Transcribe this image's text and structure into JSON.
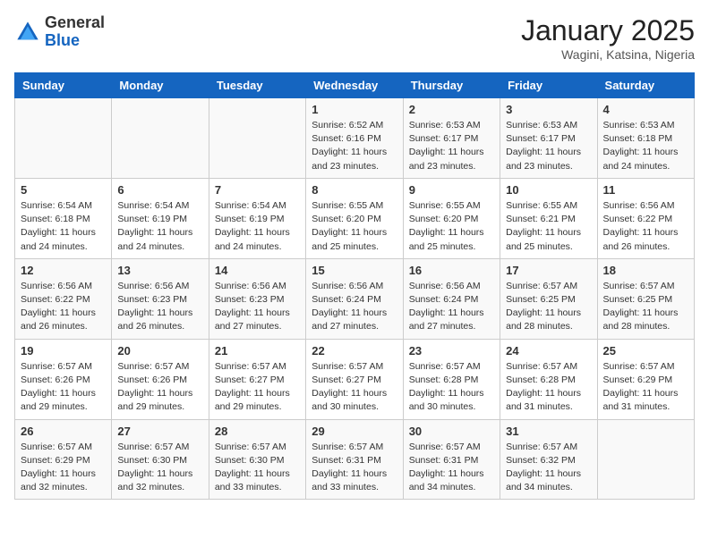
{
  "header": {
    "logo_general": "General",
    "logo_blue": "Blue",
    "month": "January 2025",
    "location": "Wagini, Katsina, Nigeria"
  },
  "weekdays": [
    "Sunday",
    "Monday",
    "Tuesday",
    "Wednesday",
    "Thursday",
    "Friday",
    "Saturday"
  ],
  "weeks": [
    [
      {
        "day": "",
        "info": ""
      },
      {
        "day": "",
        "info": ""
      },
      {
        "day": "",
        "info": ""
      },
      {
        "day": "1",
        "sunrise": "6:52 AM",
        "sunset": "6:16 PM",
        "daylight": "11 hours and 23 minutes."
      },
      {
        "day": "2",
        "sunrise": "6:53 AM",
        "sunset": "6:17 PM",
        "daylight": "11 hours and 23 minutes."
      },
      {
        "day": "3",
        "sunrise": "6:53 AM",
        "sunset": "6:17 PM",
        "daylight": "11 hours and 23 minutes."
      },
      {
        "day": "4",
        "sunrise": "6:53 AM",
        "sunset": "6:18 PM",
        "daylight": "11 hours and 24 minutes."
      }
    ],
    [
      {
        "day": "5",
        "sunrise": "6:54 AM",
        "sunset": "6:18 PM",
        "daylight": "11 hours and 24 minutes."
      },
      {
        "day": "6",
        "sunrise": "6:54 AM",
        "sunset": "6:19 PM",
        "daylight": "11 hours and 24 minutes."
      },
      {
        "day": "7",
        "sunrise": "6:54 AM",
        "sunset": "6:19 PM",
        "daylight": "11 hours and 24 minutes."
      },
      {
        "day": "8",
        "sunrise": "6:55 AM",
        "sunset": "6:20 PM",
        "daylight": "11 hours and 25 minutes."
      },
      {
        "day": "9",
        "sunrise": "6:55 AM",
        "sunset": "6:20 PM",
        "daylight": "11 hours and 25 minutes."
      },
      {
        "day": "10",
        "sunrise": "6:55 AM",
        "sunset": "6:21 PM",
        "daylight": "11 hours and 25 minutes."
      },
      {
        "day": "11",
        "sunrise": "6:56 AM",
        "sunset": "6:22 PM",
        "daylight": "11 hours and 26 minutes."
      }
    ],
    [
      {
        "day": "12",
        "sunrise": "6:56 AM",
        "sunset": "6:22 PM",
        "daylight": "11 hours and 26 minutes."
      },
      {
        "day": "13",
        "sunrise": "6:56 AM",
        "sunset": "6:23 PM",
        "daylight": "11 hours and 26 minutes."
      },
      {
        "day": "14",
        "sunrise": "6:56 AM",
        "sunset": "6:23 PM",
        "daylight": "11 hours and 27 minutes."
      },
      {
        "day": "15",
        "sunrise": "6:56 AM",
        "sunset": "6:24 PM",
        "daylight": "11 hours and 27 minutes."
      },
      {
        "day": "16",
        "sunrise": "6:56 AM",
        "sunset": "6:24 PM",
        "daylight": "11 hours and 27 minutes."
      },
      {
        "day": "17",
        "sunrise": "6:57 AM",
        "sunset": "6:25 PM",
        "daylight": "11 hours and 28 minutes."
      },
      {
        "day": "18",
        "sunrise": "6:57 AM",
        "sunset": "6:25 PM",
        "daylight": "11 hours and 28 minutes."
      }
    ],
    [
      {
        "day": "19",
        "sunrise": "6:57 AM",
        "sunset": "6:26 PM",
        "daylight": "11 hours and 29 minutes."
      },
      {
        "day": "20",
        "sunrise": "6:57 AM",
        "sunset": "6:26 PM",
        "daylight": "11 hours and 29 minutes."
      },
      {
        "day": "21",
        "sunrise": "6:57 AM",
        "sunset": "6:27 PM",
        "daylight": "11 hours and 29 minutes."
      },
      {
        "day": "22",
        "sunrise": "6:57 AM",
        "sunset": "6:27 PM",
        "daylight": "11 hours and 30 minutes."
      },
      {
        "day": "23",
        "sunrise": "6:57 AM",
        "sunset": "6:28 PM",
        "daylight": "11 hours and 30 minutes."
      },
      {
        "day": "24",
        "sunrise": "6:57 AM",
        "sunset": "6:28 PM",
        "daylight": "11 hours and 31 minutes."
      },
      {
        "day": "25",
        "sunrise": "6:57 AM",
        "sunset": "6:29 PM",
        "daylight": "11 hours and 31 minutes."
      }
    ],
    [
      {
        "day": "26",
        "sunrise": "6:57 AM",
        "sunset": "6:29 PM",
        "daylight": "11 hours and 32 minutes."
      },
      {
        "day": "27",
        "sunrise": "6:57 AM",
        "sunset": "6:30 PM",
        "daylight": "11 hours and 32 minutes."
      },
      {
        "day": "28",
        "sunrise": "6:57 AM",
        "sunset": "6:30 PM",
        "daylight": "11 hours and 33 minutes."
      },
      {
        "day": "29",
        "sunrise": "6:57 AM",
        "sunset": "6:31 PM",
        "daylight": "11 hours and 33 minutes."
      },
      {
        "day": "30",
        "sunrise": "6:57 AM",
        "sunset": "6:31 PM",
        "daylight": "11 hours and 34 minutes."
      },
      {
        "day": "31",
        "sunrise": "6:57 AM",
        "sunset": "6:32 PM",
        "daylight": "11 hours and 34 minutes."
      },
      {
        "day": "",
        "info": ""
      }
    ]
  ]
}
